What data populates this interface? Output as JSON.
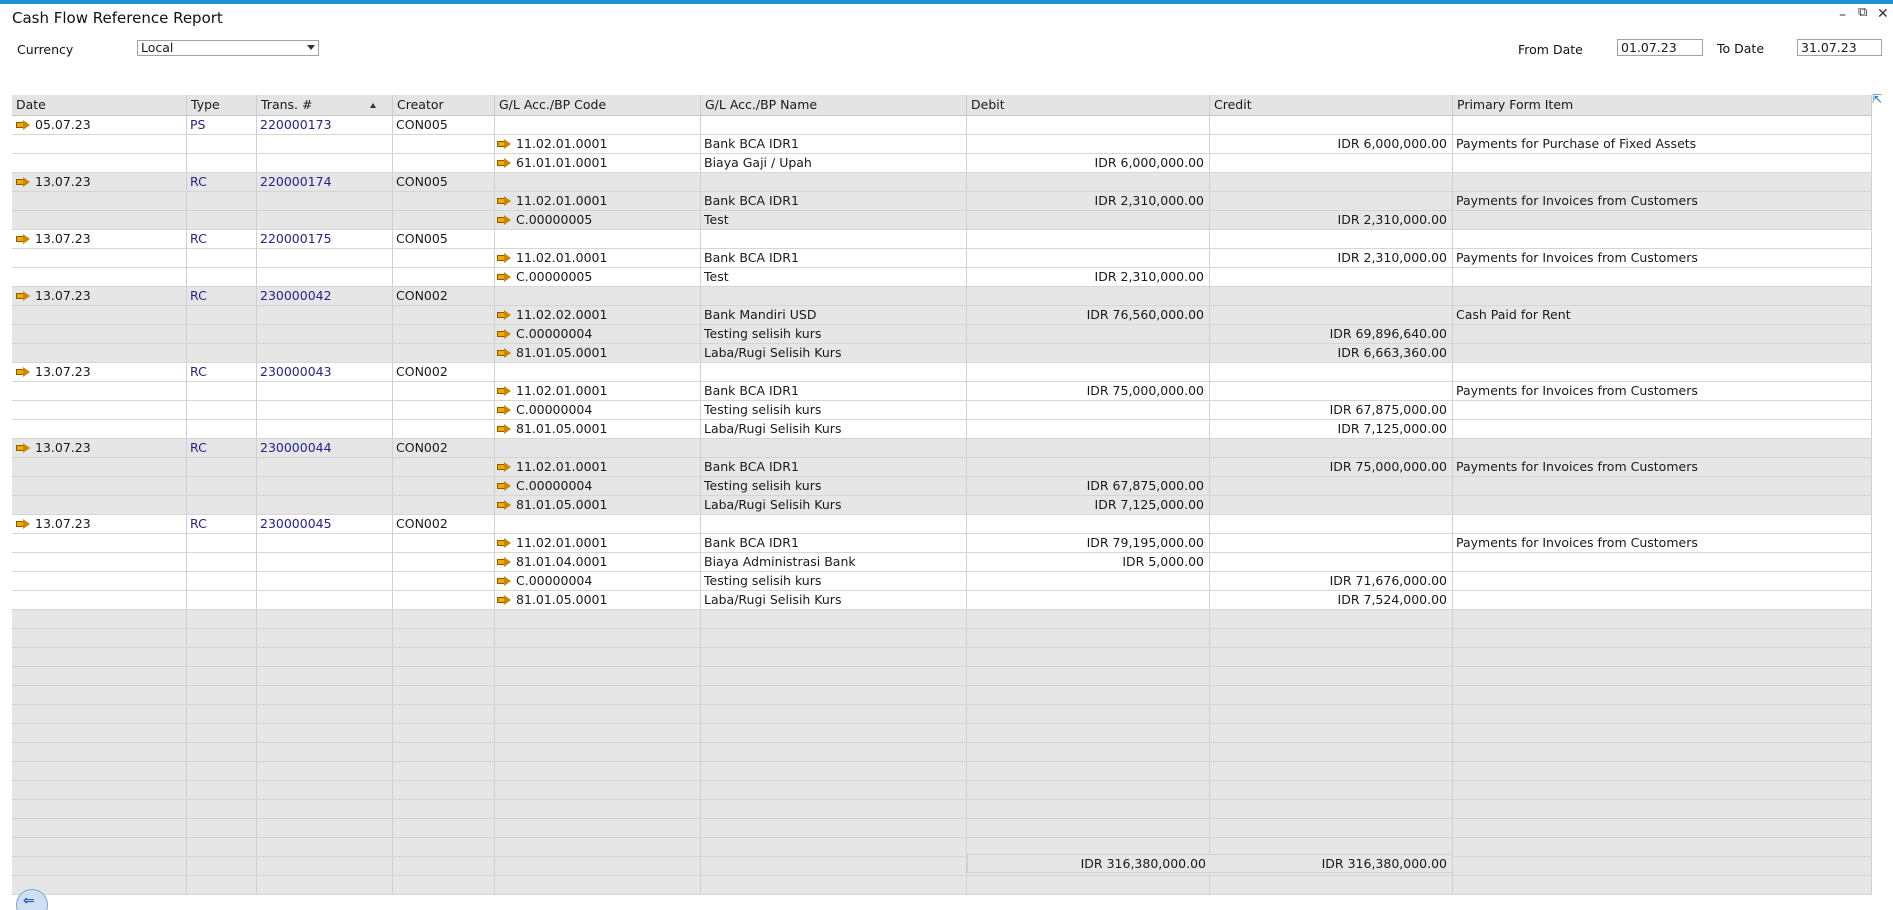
{
  "window": {
    "title": "Cash Flow Reference Report",
    "minimize_icon": "minimize-icon",
    "restore_icon": "restore-icon",
    "close_icon": "close-icon"
  },
  "filters": {
    "currency_label": "Currency",
    "currency_value": "Local",
    "from_date_label": "From Date",
    "from_date_value": "01.07.23",
    "to_date_label": "To Date",
    "to_date_value": "31.07.23"
  },
  "grid": {
    "columns": [
      "Date",
      "Type",
      "Trans. #",
      "Creator",
      "G/L Acc./BP Code",
      "G/L Acc./BP Name",
      "Debit",
      "Credit",
      "Primary Form Item"
    ],
    "sort_icon": "sort-ascending-icon",
    "link_icon": "link-arrow-icon",
    "groups": [
      {
        "date": "05.07.23",
        "type": "PS",
        "trans": "220000173",
        "creator": "CON005",
        "lines": [
          {
            "code": "11.02.01.0001",
            "name": "Bank BCA IDR1",
            "debit": "",
            "credit": "IDR 6,000,000.00",
            "form": "Payments for Purchase of Fixed Assets"
          },
          {
            "code": "61.01.01.0001",
            "name": "Biaya Gaji / Upah",
            "debit": "IDR 6,000,000.00",
            "credit": "",
            "form": ""
          }
        ]
      },
      {
        "date": "13.07.23",
        "type": "RC",
        "trans": "220000174",
        "creator": "CON005",
        "lines": [
          {
            "code": "11.02.01.0001",
            "name": "Bank BCA IDR1",
            "debit": "IDR 2,310,000.00",
            "credit": "",
            "form": "Payments for Invoices from Customers"
          },
          {
            "code": "C.00000005",
            "name": "Test",
            "debit": "",
            "credit": "IDR 2,310,000.00",
            "form": ""
          }
        ]
      },
      {
        "date": "13.07.23",
        "type": "RC",
        "trans": "220000175",
        "creator": "CON005",
        "lines": [
          {
            "code": "11.02.01.0001",
            "name": "Bank BCA IDR1",
            "debit": "",
            "credit": "IDR 2,310,000.00",
            "form": "Payments for Invoices from Customers"
          },
          {
            "code": "C.00000005",
            "name": "Test",
            "debit": "IDR 2,310,000.00",
            "credit": "",
            "form": ""
          }
        ]
      },
      {
        "date": "13.07.23",
        "type": "RC",
        "trans": "230000042",
        "creator": "CON002",
        "lines": [
          {
            "code": "11.02.02.0001",
            "name": "Bank Mandiri USD",
            "debit": "IDR 76,560,000.00",
            "credit": "",
            "form": "Cash Paid for Rent"
          },
          {
            "code": "C.00000004",
            "name": "Testing selisih kurs",
            "debit": "",
            "credit": "IDR 69,896,640.00",
            "form": ""
          },
          {
            "code": "81.01.05.0001",
            "name": "Laba/Rugi Selisih Kurs",
            "debit": "",
            "credit": "IDR 6,663,360.00",
            "form": ""
          }
        ]
      },
      {
        "date": "13.07.23",
        "type": "RC",
        "trans": "230000043",
        "creator": "CON002",
        "lines": [
          {
            "code": "11.02.01.0001",
            "name": "Bank BCA IDR1",
            "debit": "IDR 75,000,000.00",
            "credit": "",
            "form": "Payments for Invoices from Customers"
          },
          {
            "code": "C.00000004",
            "name": "Testing selisih kurs",
            "debit": "",
            "credit": "IDR 67,875,000.00",
            "form": ""
          },
          {
            "code": "81.01.05.0001",
            "name": "Laba/Rugi Selisih Kurs",
            "debit": "",
            "credit": "IDR 7,125,000.00",
            "form": ""
          }
        ]
      },
      {
        "date": "13.07.23",
        "type": "RC",
        "trans": "230000044",
        "creator": "CON002",
        "lines": [
          {
            "code": "11.02.01.0001",
            "name": "Bank BCA IDR1",
            "debit": "",
            "credit": "IDR 75,000,000.00",
            "form": "Payments for Invoices from Customers"
          },
          {
            "code": "C.00000004",
            "name": "Testing selisih kurs",
            "debit": "IDR 67,875,000.00",
            "credit": "",
            "form": ""
          },
          {
            "code": "81.01.05.0001",
            "name": "Laba/Rugi Selisih Kurs",
            "debit": "IDR 7,125,000.00",
            "credit": "",
            "form": ""
          }
        ]
      },
      {
        "date": "13.07.23",
        "type": "RC",
        "trans": "230000045",
        "creator": "CON002",
        "lines": [
          {
            "code": "11.02.01.0001",
            "name": "Bank BCA IDR1",
            "debit": "IDR 79,195,000.00",
            "credit": "",
            "form": "Payments for Invoices from Customers"
          },
          {
            "code": "81.01.04.0001",
            "name": "Biaya Administrasi Bank",
            "debit": "IDR 5,000.00",
            "credit": "",
            "form": ""
          },
          {
            "code": "C.00000004",
            "name": "Testing selisih kurs",
            "debit": "",
            "credit": "IDR 71,676,000.00",
            "form": ""
          },
          {
            "code": "81.01.05.0001",
            "name": "Laba/Rugi Selisih Kurs",
            "debit": "",
            "credit": "IDR 7,524,000.00",
            "form": ""
          }
        ]
      }
    ],
    "empty_rows": 15
  },
  "totals": {
    "debit": "IDR 316,380,000.00",
    "credit": "IDR 316,380,000.00"
  },
  "footer": {
    "back_icon": "back-arrow-icon"
  }
}
